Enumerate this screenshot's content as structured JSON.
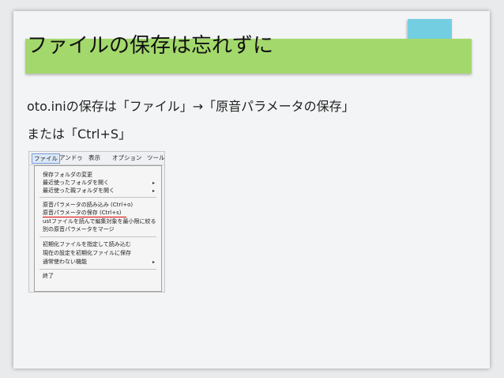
{
  "slide": {
    "title": "ファイルの保存は忘れずに",
    "line1": "oto.iniの保存は「ファイル」→「原音パラメータの保存」",
    "line2": "または「Ctrl+S」"
  },
  "menubar": {
    "items": [
      "ファイル",
      "アンドゥ",
      "表示",
      "オプション",
      "ツール"
    ]
  },
  "file_menu": {
    "items": [
      "保存フォルダの変更",
      "最近使ったフォルダを開く",
      "最近使った親フォルダを開く",
      "原音パラメータの読み込み (Ctrl+o)",
      "原音パラメータの保存    (Ctrl+s)",
      "ustファイルを読んで編集対象を最小限に絞る",
      "別の原音パラメータをマージ",
      "初期化ファイルを指定して読み込む",
      "現在の設定を初期化ファイルに保存",
      "通常使わない機能",
      "終了"
    ],
    "submenu_arrow": "▸"
  },
  "colors": {
    "title_bar": "#a3d96c",
    "accent_square": "#74cee2",
    "highlight_underline": "#e00000"
  }
}
